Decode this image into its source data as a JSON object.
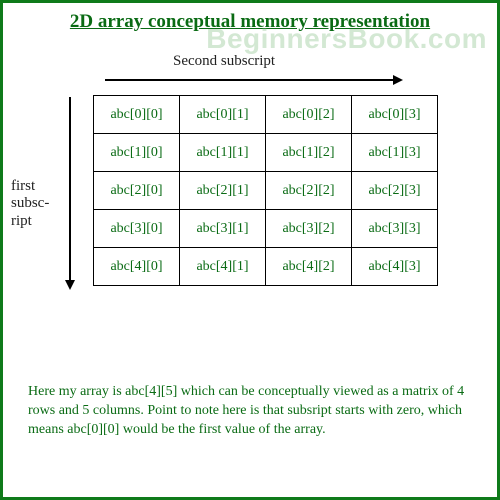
{
  "watermark": "BeginnersBook.com",
  "title": "2D array conceptual memory representation",
  "axes": {
    "horizontal": "Second subscript",
    "vertical": "first subsc-ript"
  },
  "grid": {
    "rows": [
      [
        "abc[0][0]",
        "abc[0][1]",
        "abc[0][2]",
        "abc[0][3]"
      ],
      [
        "abc[1][0]",
        "abc[1][1]",
        "abc[1][2]",
        "abc[1][3]"
      ],
      [
        "abc[2][0]",
        "abc[2][1]",
        "abc[2][2]",
        "abc[2][3]"
      ],
      [
        "abc[3][0]",
        "abc[3][1]",
        "abc[3][2]",
        "abc[3][3]"
      ],
      [
        "abc[4][0]",
        "abc[4][1]",
        "abc[4][2]",
        "abc[4][3]"
      ]
    ]
  },
  "description": "Here my array is abc[4][5] which can be conceptually viewed as a matrix of 4 rows and 5 columns. Point to note here is that subsript starts with zero, which means abc[0][0] would be the first value of the array.",
  "colors": {
    "border": "#0f7a1a",
    "text": "#0a6b14"
  }
}
